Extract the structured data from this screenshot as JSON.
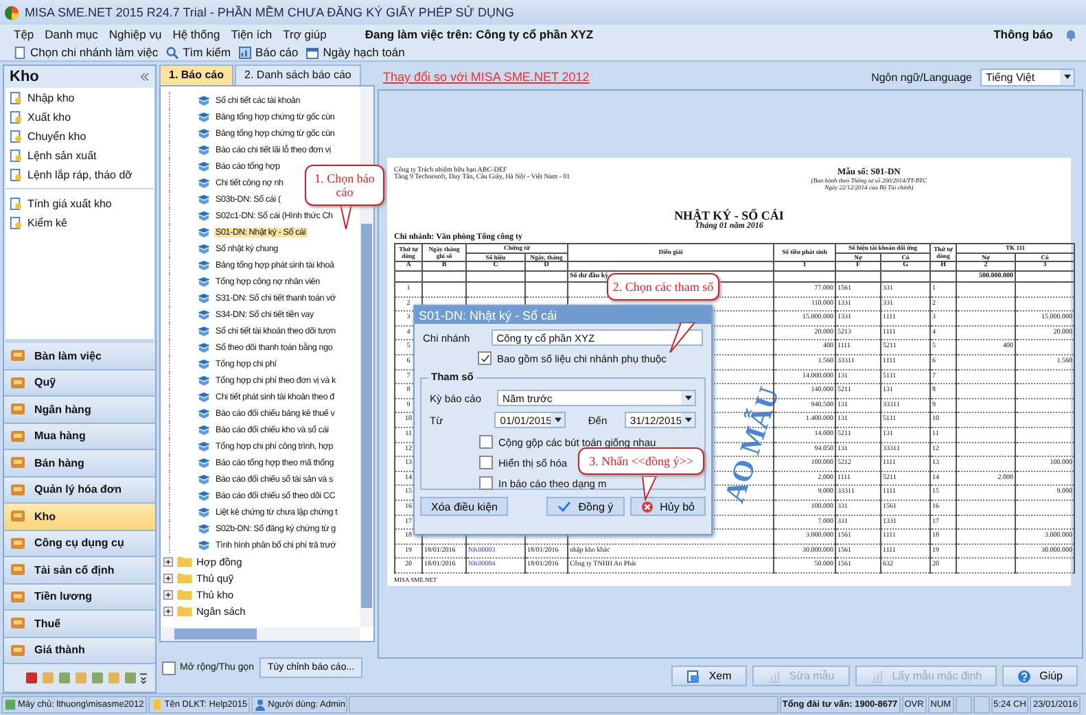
{
  "window": {
    "title": "MISA SME.NET 2015 R24.7 Trial - PHẦN MỀM CHƯA ĐĂNG KÝ GIẤY PHÉP SỬ DỤNG"
  },
  "menu": [
    "Tệp",
    "Danh mục",
    "Nghiệp vụ",
    "Hệ thống",
    "Tiện ích",
    "Trợ giúp"
  ],
  "working_on": {
    "label": "Đang làm việc trên:",
    "company": "Công ty cổ phần XYZ"
  },
  "notifications": "Thông báo",
  "toolbar": [
    "Chọn chi nhánh làm việc",
    "Tìm kiếm",
    "Báo cáo",
    "Ngày hạch toán"
  ],
  "module": {
    "title": "Kho",
    "groups": [
      [
        "Nhập kho",
        "Xuất kho",
        "Chuyển kho",
        "Lệnh sản xuất",
        "Lệnh lắp ráp, tháo dỡ"
      ],
      [
        "Tính giá xuất kho",
        "Kiểm kê"
      ]
    ]
  },
  "nav": [
    {
      "label": "Bàn làm việc",
      "selected": false
    },
    {
      "label": "Quỹ",
      "selected": false
    },
    {
      "label": "Ngân hàng",
      "selected": false
    },
    {
      "label": "Mua hàng",
      "selected": false
    },
    {
      "label": "Bán hàng",
      "selected": false
    },
    {
      "label": "Quản lý hóa đơn",
      "selected": false
    },
    {
      "label": "Kho",
      "selected": true
    },
    {
      "label": "Công cụ dụng cụ",
      "selected": false
    },
    {
      "label": "Tài sản cố định",
      "selected": false
    },
    {
      "label": "Tiền lương",
      "selected": false
    },
    {
      "label": "Thuế",
      "selected": false
    },
    {
      "label": "Giá thành",
      "selected": false
    }
  ],
  "report_tabs": [
    {
      "label": "1. Báo cáo",
      "selected": true
    },
    {
      "label": "2. Danh sách báo cáo",
      "selected": false
    }
  ],
  "reports": [
    {
      "label": "Sổ chi tiết các tài khoản",
      "selected": false
    },
    {
      "label": "Bảng tổng hợp chứng từ gốc cùn",
      "selected": false
    },
    {
      "label": "Bảng tổng hợp chứng từ gốc cùn",
      "selected": false
    },
    {
      "label": "Báo cáo chi tiết lãi lỗ theo đơn vị",
      "selected": false
    },
    {
      "label": "Báo cáo tổng hợp",
      "selected": false
    },
    {
      "label": "Chi tiết công nợ nh",
      "selected": false
    },
    {
      "label": "S03b-DN: Sổ cái (",
      "selected": false
    },
    {
      "label": "S02c1-DN: Sổ cái (Hình thức Ch",
      "selected": false
    },
    {
      "label": "S01-DN: Nhật ký - Sổ cái",
      "selected": true
    },
    {
      "label": "Sổ nhật ký chung",
      "selected": false
    },
    {
      "label": "Bảng tổng hợp phát sinh tài khoả",
      "selected": false
    },
    {
      "label": "Tổng hợp công nợ nhân viên",
      "selected": false
    },
    {
      "label": "S31-DN: Sổ chi tiết thanh toán vớ",
      "selected": false
    },
    {
      "label": "S34-DN: Sổ chi tiết tiền vay",
      "selected": false
    },
    {
      "label": "Sổ chi tiết tài khoản theo dõi tươn",
      "selected": false
    },
    {
      "label": "Sổ theo dõi thanh toán bằng ngo",
      "selected": false
    },
    {
      "label": "Tổng hợp chi phí",
      "selected": false
    },
    {
      "label": "Tổng hợp chi phí theo đơn vị và k",
      "selected": false
    },
    {
      "label": "Chi tiết phát sinh tài khoản theo đ",
      "selected": false
    },
    {
      "label": "Báo cáo đối chiếu bảng kê thuế v",
      "selected": false
    },
    {
      "label": "Báo cáo đối chiếu kho và sổ cái",
      "selected": false
    },
    {
      "label": "Tổng hợp chi phí công trình, hợp",
      "selected": false
    },
    {
      "label": "Báo cáo tổng hợp theo mã thống",
      "selected": false
    },
    {
      "label": "Báo cáo đối chiếu sổ tài sản và s",
      "selected": false
    },
    {
      "label": "Báo cáo đối chiếu sổ theo dõi CC",
      "selected": false
    },
    {
      "label": "Liệt kê chứng từ chưa lập chứng t",
      "selected": false
    },
    {
      "label": "S02b-DN: Sổ đăng ký chứng từ g",
      "selected": false
    },
    {
      "label": "Tình hình phân bổ chi phí trả trướ",
      "selected": false
    }
  ],
  "folders": [
    {
      "label": "Hợp đồng",
      "expanded": false
    },
    {
      "label": "Thủ quỹ",
      "expanded": false
    },
    {
      "label": "Thủ kho",
      "expanded": false
    },
    {
      "label": "Ngân sách",
      "expanded": false
    }
  ],
  "expand_toggle": {
    "label": "Mở rộng/Thu gọn",
    "checked": false
  },
  "customize_button": "Tùy chỉnh báo cáo...",
  "change_link": "Thay đổi so với MISA SME.NET 2012",
  "language": {
    "label": "Ngôn ngữ/Language",
    "value": "Tiếng Việt"
  },
  "preview": {
    "company": "Công ty Trách nhiệm hữu hạn ABC-DEF",
    "address": "Tầng 9 Technosoft, Duy Tân, Cầu Giấy, Hà Nội - Việt Nam - 01",
    "form_no": "Mẫu số: S01-DN",
    "issued": [
      "(Ban hành theo Thông tư số 200/2014/TT-BTC",
      "Ngày 22/12/2014 của Bộ Tài chính)"
    ],
    "title": "NHẬT KÝ - SỔ CÁI",
    "period": "Tháng 01 năm 2016",
    "branch": "Chi nhánh: Văn phòng Tổng công ty",
    "head_top": [
      "Thứ tự dòng",
      "Ngày tháng ghi sổ",
      "Chứng từ",
      "Diễn giải",
      "Số tiền phát sinh",
      "Số hiệu tài khoản đối ứng",
      "Thứ tự dòng",
      "TK 111"
    ],
    "head_sub": [
      "Số hiệu",
      "Ngày, tháng",
      "Nợ",
      "Có",
      "Nợ",
      "Có"
    ],
    "letters": [
      "A",
      "B",
      "C",
      "D",
      "1",
      "F",
      "G",
      "H",
      "2",
      "3"
    ],
    "opening": {
      "label": "Số dư đầu kỳ",
      "debit": "500.000.000"
    },
    "rows": [
      [
        "1",
        "",
        "",
        "",
        "",
        "77.000",
        "1561",
        "331",
        "1",
        "",
        ""
      ],
      [
        "2",
        "",
        "",
        "",
        "",
        "110.000",
        "1331",
        "331",
        "2",
        "",
        ""
      ],
      [
        "3",
        "",
        "",
        "",
        "",
        "15.000.000",
        "1331",
        "1111",
        "3",
        "",
        "15.000.000"
      ],
      [
        "4",
        "",
        "",
        "",
        "",
        "20.000",
        "5213",
        "1111",
        "4",
        "",
        "20.000"
      ],
      [
        "5",
        "",
        "",
        "",
        "",
        "400",
        "1111",
        "5211",
        "5",
        "400",
        ""
      ],
      [
        "6",
        "",
        "",
        "",
        "",
        "1.560",
        "33311",
        "1111",
        "6",
        "",
        "1.560"
      ],
      [
        "7",
        "",
        "",
        "",
        "",
        "14.000.000",
        "131",
        "5111",
        "7",
        "",
        ""
      ],
      [
        "8",
        "",
        "",
        "",
        "",
        "140.000",
        "5211",
        "131",
        "8",
        "",
        ""
      ],
      [
        "9",
        "",
        "",
        "",
        "",
        "940.500",
        "131",
        "33311",
        "9",
        "",
        ""
      ],
      [
        "10",
        "",
        "",
        "",
        "",
        "1.400.000",
        "131",
        "5111",
        "10",
        "",
        ""
      ],
      [
        "11",
        "",
        "",
        "",
        "",
        "14.000",
        "5211",
        "131",
        "11",
        "",
        ""
      ],
      [
        "12",
        "",
        "",
        "",
        "",
        "94.050",
        "131",
        "33311",
        "12",
        "",
        ""
      ],
      [
        "13",
        "",
        "",
        "",
        "",
        "100.000",
        "5212",
        "1111",
        "13",
        "",
        "100.000"
      ],
      [
        "14",
        "",
        "",
        "",
        "",
        "2.000",
        "1111",
        "5211",
        "14",
        "2.000",
        ""
      ],
      [
        "15",
        "",
        "",
        "",
        "",
        "9.000",
        "33311",
        "1111",
        "15",
        "",
        "9.000"
      ],
      [
        "16",
        "",
        "",
        "",
        "",
        "100.000",
        "331",
        "1561",
        "16",
        "",
        ""
      ],
      [
        "17",
        "",
        "",
        "",
        "",
        "7.000",
        "331",
        "1331",
        "17",
        "",
        ""
      ],
      [
        "18",
        "",
        "",
        "",
        "",
        "3.000.000",
        "1561",
        "1111",
        "18",
        "",
        "3.000.000"
      ],
      [
        "19",
        "18/01/2016",
        "NK00003",
        "18/01/2016",
        "nhập kho khác",
        "30.000.000",
        "1561",
        "1111",
        "19",
        "",
        "30.000.000"
      ],
      [
        "20",
        "18/01/2016",
        "NK00004",
        "18/01/2016",
        "Công ty TNHH An Phát",
        "50.000",
        "1561",
        "632",
        "20",
        "",
        ""
      ]
    ],
    "footer": "MISA SME.NET",
    "stamp": "AO MẪU"
  },
  "dialog": {
    "title": "S01-DN: Nhật ký - Sổ cái",
    "branch_label": "Chi nhánh",
    "branch": "Công ty cổ phần XYZ",
    "include_dependent": {
      "label": "Bao gồm số liệu chi nhánh phụ thuộc",
      "checked": true
    },
    "group_title": "Tham số",
    "period_label": "Kỳ báo cáo",
    "period": "Năm trước",
    "from_label": "Từ",
    "from": "01/01/2015",
    "to_label": "Đến",
    "to": "31/12/2015",
    "options": [
      {
        "label": "Cộng gộp các bút toán giống nhau",
        "checked": false
      },
      {
        "label": "Hiển thị số hóa",
        "checked": false
      },
      {
        "label": "In báo cáo theo dạng m",
        "checked": false
      }
    ],
    "clear_button": "Xóa điều kiện",
    "ok_button": "Đồng ý",
    "cancel_button": "Hủy bỏ"
  },
  "callouts": [
    "1. Chọn báo cáo",
    "2. Chọn các tham số",
    "3. Nhấn <<đồng ý>>"
  ],
  "actions": [
    {
      "label": "Xem",
      "kind": "view",
      "disabled": false
    },
    {
      "label": "Sửa mẫu",
      "kind": "edit",
      "disabled": true
    },
    {
      "label": "Lấy mẫu mặc định",
      "kind": "default",
      "disabled": true
    },
    {
      "label": "Giúp",
      "kind": "help",
      "disabled": false
    }
  ],
  "status_bar": {
    "left": [
      "Máy chủ: lthuong\\misasme2012",
      "Tên DLKT: Help2015",
      "Người dùng: Admin"
    ],
    "hotline": "Tổng đài tư vấn: 1900-8677",
    "indicators": [
      "OVR",
      "NUM"
    ],
    "time": "5:24 CH",
    "date": "23/01/2016"
  }
}
